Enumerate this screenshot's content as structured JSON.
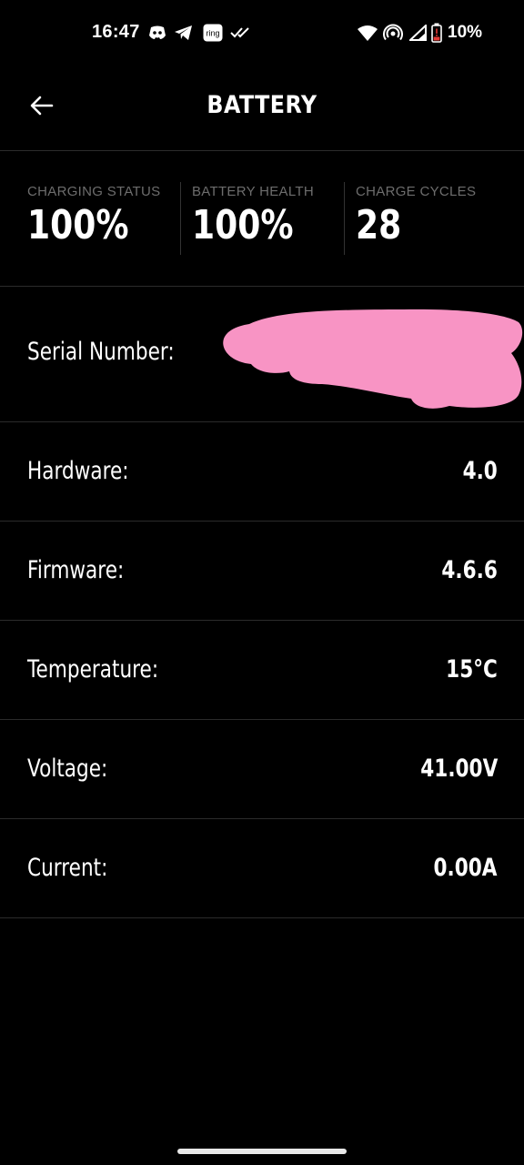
{
  "status_bar": {
    "time": "16:47",
    "battery_percent": "10%",
    "notification_icons": [
      "discord-icon",
      "telegram-icon",
      "ring-icon",
      "double-check-icon"
    ],
    "ring_label": "ring",
    "system_icons": [
      "wifi-icon",
      "hotspot-icon",
      "signal-icon",
      "battery-low-icon"
    ],
    "battery_low_color": "#e53935"
  },
  "header": {
    "title": "BATTERY",
    "back_icon": "arrow-left-icon"
  },
  "stats": [
    {
      "label": "CHARGING STATUS",
      "value": "100%"
    },
    {
      "label": "BATTERY HEALTH",
      "value": "100%"
    },
    {
      "label": "CHARGE CYCLES",
      "value": "28"
    }
  ],
  "details": {
    "serial": {
      "label": "Serial Number:",
      "redaction_color": "#f894c4"
    },
    "hardware": {
      "label": "Hardware:",
      "value": "4.0"
    },
    "firmware": {
      "label": "Firmware:",
      "value": "4.6.6"
    },
    "temperature": {
      "label": "Temperature:",
      "value": "15°C"
    },
    "voltage": {
      "label": "Voltage:",
      "value": "41.00V"
    },
    "current": {
      "label": "Current:",
      "value": "0.00A"
    }
  },
  "colors": {
    "background": "#000000",
    "text": "#ffffff",
    "muted_label": "#6d6d6d",
    "divider": "#2b2b2b"
  }
}
